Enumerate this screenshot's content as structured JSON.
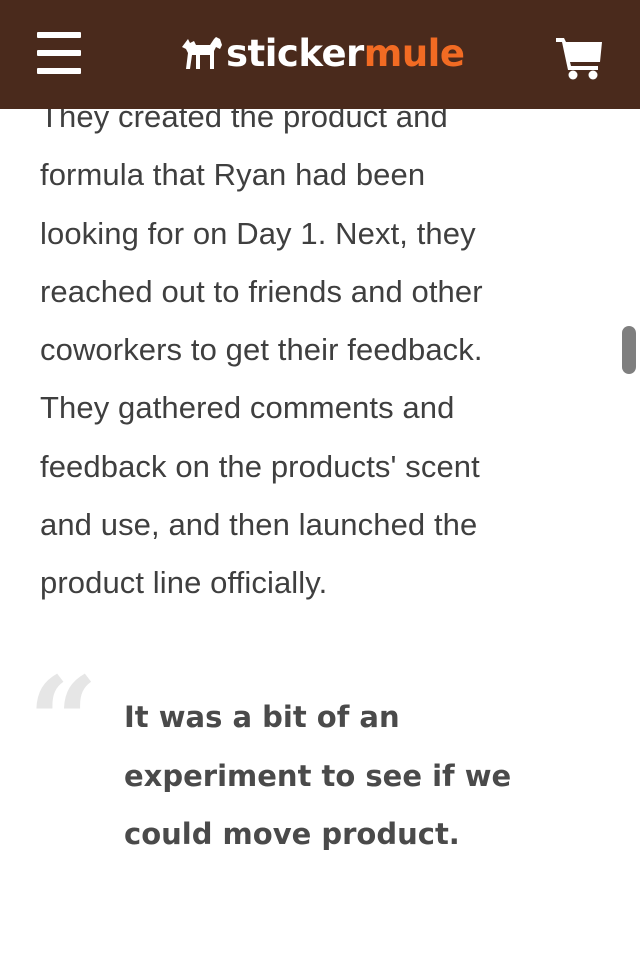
{
  "header": {
    "brand_part1": "sticker",
    "brand_part2": "mule",
    "background_color": "#4a2a1c",
    "accent_color": "#f26b23",
    "menu_icon": "hamburger-menu-icon",
    "logo_icon": "mule-logo-icon",
    "cart_icon": "shopping-cart-icon"
  },
  "article": {
    "lines": [
      "They created the product and",
      "formula that Ryan had been",
      "looking for on Day 1. Next, they",
      "reached out to friends and other",
      "coworkers to get their feedback.",
      "They gathered comments and",
      "feedback on the products' scent",
      "and use, and then launched the",
      "product line officially."
    ]
  },
  "quote": {
    "mark": "“",
    "lines": [
      "It was a bit of an",
      "experiment to see if we",
      "could move product."
    ]
  }
}
